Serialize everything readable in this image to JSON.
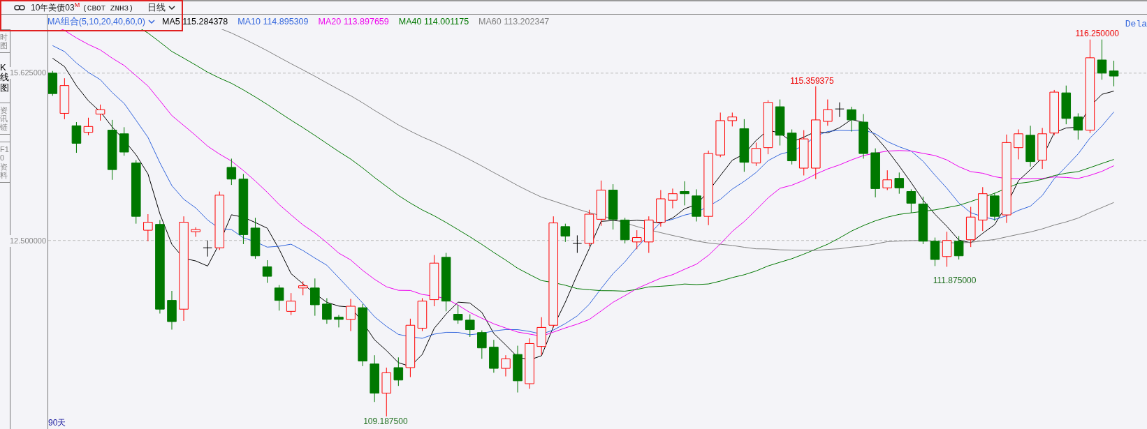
{
  "header": {
    "instrument": "10年美债03",
    "badge": "M",
    "code": "(CBOT ZNH3)",
    "period": "日线"
  },
  "ma_bar": {
    "preset": "MA组合(5,10,20,40,60,0)",
    "lines": [
      {
        "text": "MA5 115.284378",
        "color": "#000000"
      },
      {
        "text": "MA10 114.895309",
        "color": "#3366dd"
      },
      {
        "text": "MA20 113.897659",
        "color": "#ee00ee"
      },
      {
        "text": "MA40 114.001175",
        "color": "#007700"
      },
      {
        "text": "MA60 113.202347",
        "color": "#808080"
      }
    ]
  },
  "status_label": "Dela",
  "side_tabs": [
    {
      "label": "时图",
      "selected": false
    },
    {
      "label": "K线图",
      "selected": true
    },
    {
      "label": "资讯链",
      "selected": false
    },
    {
      "label": "F10资料",
      "selected": false
    }
  ],
  "price_axis": [
    "15.625000",
    "12.500000"
  ],
  "chart": {
    "annotations": [
      {
        "text": "116.250000",
        "kind": "high"
      },
      {
        "text": "115.359375",
        "kind": "high"
      },
      {
        "text": "111.875000",
        "kind": "low"
      },
      {
        "text": "109.187500",
        "kind": "low"
      }
    ],
    "range_label": "90天"
  }
}
